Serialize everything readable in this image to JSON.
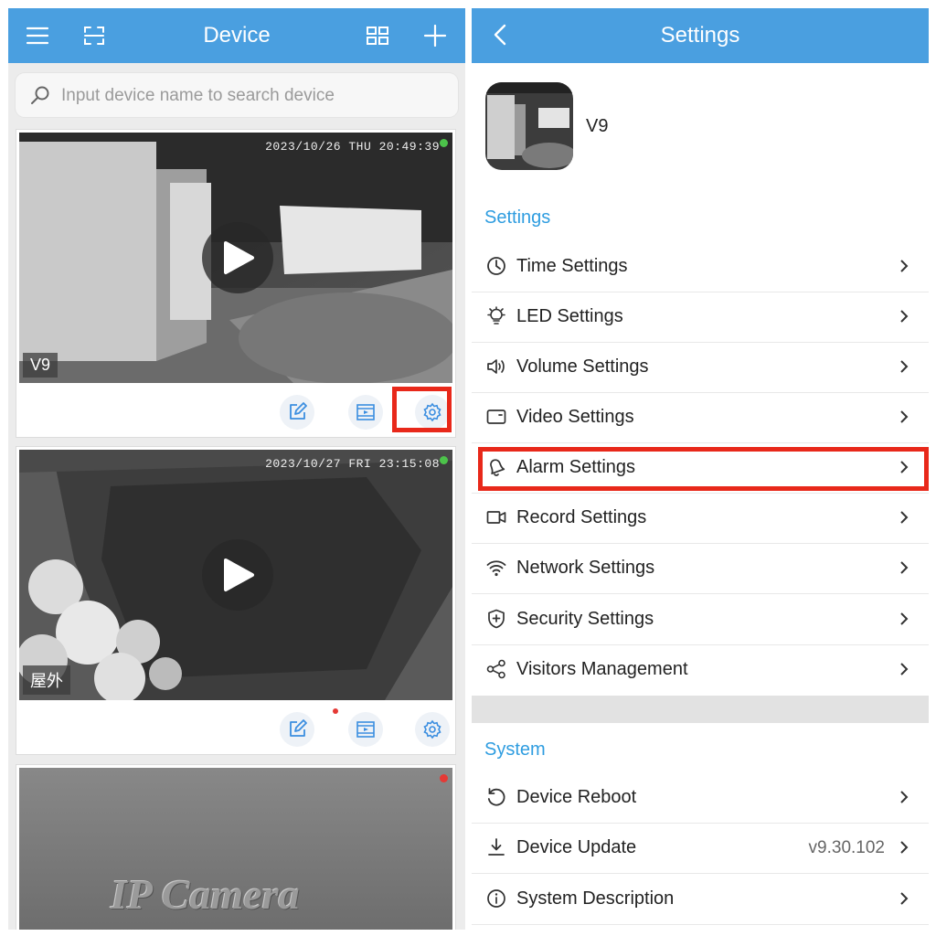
{
  "left": {
    "header": {
      "title": "Device"
    },
    "search": {
      "placeholder": "Input device name to search device"
    },
    "cards": [
      {
        "timestamp": "2023/10/26 THU 20:49:39",
        "name": "V9",
        "status_color": "#4cc34a"
      },
      {
        "timestamp": "2023/10/27 FRI 23:15:08",
        "name": "屋外",
        "status_color": "#4cc34a"
      },
      {
        "overlay_text": "IP Camera",
        "status_color": "#e53935"
      }
    ]
  },
  "right": {
    "header": {
      "title": "Settings"
    },
    "device": {
      "name": "V9"
    },
    "sections": {
      "settings": {
        "title": "Settings",
        "items": [
          {
            "label": "Time Settings",
            "icon": "clock-icon"
          },
          {
            "label": "LED Settings",
            "icon": "lightbulb-icon"
          },
          {
            "label": "Volume Settings",
            "icon": "speaker-icon"
          },
          {
            "label": "Video Settings",
            "icon": "video-frame-icon"
          },
          {
            "label": "Alarm Settings",
            "icon": "bell-icon"
          },
          {
            "label": "Record Settings",
            "icon": "video-camera-icon"
          },
          {
            "label": "Network Settings",
            "icon": "wifi-icon"
          },
          {
            "label": "Security Settings",
            "icon": "shield-icon"
          },
          {
            "label": "Visitors Management",
            "icon": "share-icon"
          }
        ]
      },
      "system": {
        "title": "System",
        "items": [
          {
            "label": "Device Reboot",
            "icon": "reboot-icon"
          },
          {
            "label": "Device Update",
            "icon": "download-icon",
            "value": "v9.30.102"
          },
          {
            "label": "System Description",
            "icon": "info-icon"
          }
        ]
      }
    }
  },
  "colors": {
    "accent": "#4a9fe0",
    "highlight": "#e8281a",
    "section_title": "#2f9de0"
  }
}
